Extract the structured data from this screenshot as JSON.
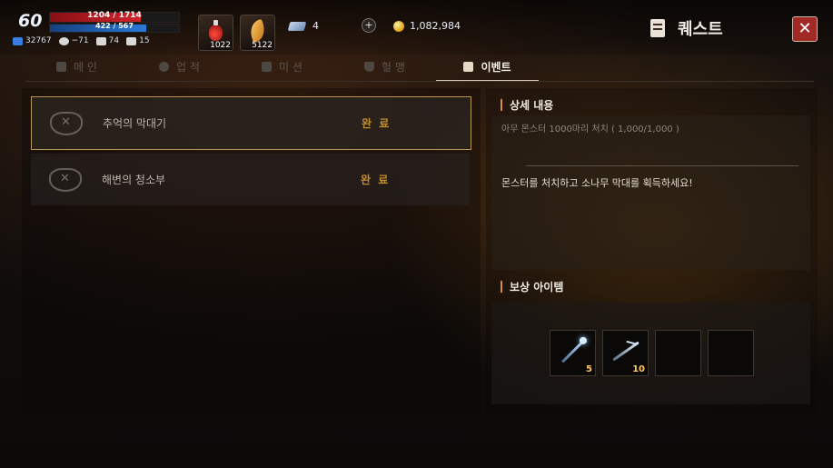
{
  "hud": {
    "level": "60",
    "hp": {
      "text": "1204 / 1714",
      "fraction": 0.7025
    },
    "mp": {
      "text": "422 / 567",
      "fraction": 0.7443
    },
    "stats": [
      {
        "icon": "experience-icon",
        "value": "32767",
        "color": "#3a7de0"
      },
      {
        "icon": "skull-icon",
        "value": "−71",
        "color": "#d8d8d8"
      },
      {
        "icon": "boot-icon",
        "value": "74",
        "color": "#d8d8d8"
      },
      {
        "icon": "speed-icon",
        "value": "15",
        "color": "#d8d8d8"
      }
    ],
    "slots": [
      {
        "icon": "red-potion-icon",
        "qty": "1022"
      },
      {
        "icon": "golden-leaf-icon",
        "qty": "5122"
      }
    ],
    "ticket": {
      "icon": "ticket-icon",
      "value": "4"
    },
    "gold": {
      "icon": "gold-coin-icon",
      "value": "1,082,984"
    }
  },
  "window": {
    "title": "퀘스트",
    "title_icon": "scroll-icon",
    "close_icon": "close-icon"
  },
  "tabs": [
    {
      "label": "메 인",
      "icon": "list-icon",
      "active": false
    },
    {
      "label": "업 적",
      "icon": "medal-icon",
      "active": false
    },
    {
      "label": "미 션",
      "icon": "flag-icon",
      "active": false
    },
    {
      "label": "혈 맹",
      "icon": "shield-icon",
      "active": false
    },
    {
      "label": "이벤트",
      "icon": "gift-icon",
      "active": true
    }
  ],
  "quests": [
    {
      "name": "추억의 막대기",
      "status": "완 료",
      "selected": true
    },
    {
      "name": "해변의 청소부",
      "status": "완 료",
      "selected": false
    }
  ],
  "detail": {
    "header": "상세 내용",
    "condition": "아무 몬스터 1000마리 처치 ( 1,000/1,000 )",
    "description": "몬스터를 처치하고 소나무 막대를 획득하세요!"
  },
  "reward": {
    "header": "보상 아이템",
    "items": [
      {
        "icon": "magic-wand-icon",
        "qty": "5"
      },
      {
        "icon": "pine-stick-icon",
        "qty": "10"
      },
      {
        "icon": "",
        "qty": ""
      },
      {
        "icon": "",
        "qty": ""
      }
    ]
  },
  "colors": {
    "accent_gold": "#c28d2e",
    "close_red": "#a12a26",
    "hp_red": "#d0242b",
    "mp_blue": "#2a7ad8"
  }
}
